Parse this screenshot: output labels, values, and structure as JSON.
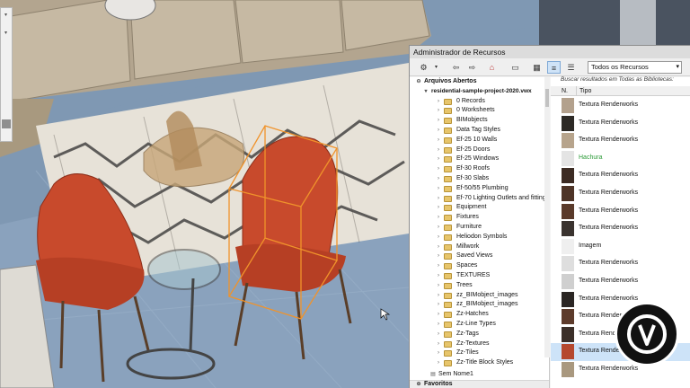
{
  "window": {
    "title": "Administrador de Recursos"
  },
  "toolbar": {
    "filter_label": "Todos os Recursos"
  },
  "search": {
    "hint": "Buscar resultados em Todas as Bibliotecas:"
  },
  "columns": {
    "n": "N.",
    "tipo": "Tipo"
  },
  "tree": {
    "section_open": "Arquivos Abertos",
    "file_name": "residential-sample-project-2020.vwx",
    "items": [
      "0 Records",
      "0 Worksheets",
      "BIMobjects",
      "Data Tag Styles",
      "Ef-25 10 Walls",
      "Ef-25 Doors",
      "Ef-25 Windows",
      "Ef-30 Roofs",
      "Ef-30 Slabs",
      "Ef-50/55 Plumbing",
      "Ef-70 Lighting Outlets and fittings",
      "Equipment",
      "Fixtures",
      "Furniture",
      "Heliodon Symbols",
      "Millwork",
      "Saved Views",
      "Spaces",
      "TEXTURES",
      "Trees",
      "zz_BIMobject_images",
      "zz_BIMobject_images",
      "Zz-Hatches",
      "Zz-Line Types",
      "Zz-Tags",
      "Zz-Textures",
      "Zz-Tiles",
      "Zz-Title Block Styles"
    ],
    "other_file": "Sem Nome1",
    "section_favorites": "Favoritos"
  },
  "resources": [
    {
      "name": "Textura Renderworks",
      "color": "#b3a18d"
    },
    {
      "name": "Textura Renderworks",
      "color": "#2d2a26"
    },
    {
      "name": "Textura Renderworks",
      "color": "#b7a48c"
    },
    {
      "name": "Hachura",
      "color": "#e4e4e4"
    },
    {
      "name": "Textura Renderworks",
      "color": "#3c2b23"
    },
    {
      "name": "Textura Renderworks",
      "color": "#4e3427"
    },
    {
      "name": "Textura Renderworks",
      "color": "#5a3a2a"
    },
    {
      "name": "Textura Renderworks",
      "color": "#3a332f"
    },
    {
      "name": "Imagem",
      "color": "#efefef"
    },
    {
      "name": "Textura Renderworks",
      "color": "#dedede"
    },
    {
      "name": "Textura Renderworks",
      "color": "#cfcfcf"
    },
    {
      "name": "Textura Renderworks",
      "color": "#2b2624"
    },
    {
      "name": "Textura Renderworks",
      "color": "#5d3b2b"
    },
    {
      "name": "Textura Renderworks",
      "color": "#3b2f29"
    },
    {
      "name": "Textura Renderworks",
      "color": "#b5482e"
    },
    {
      "name": "Textura Renderworks",
      "color": "#a9987f"
    }
  ],
  "colors": {
    "hatch_label": "#2e9c3a",
    "selection": "#cde3f8",
    "folder": "#e7c56b"
  }
}
